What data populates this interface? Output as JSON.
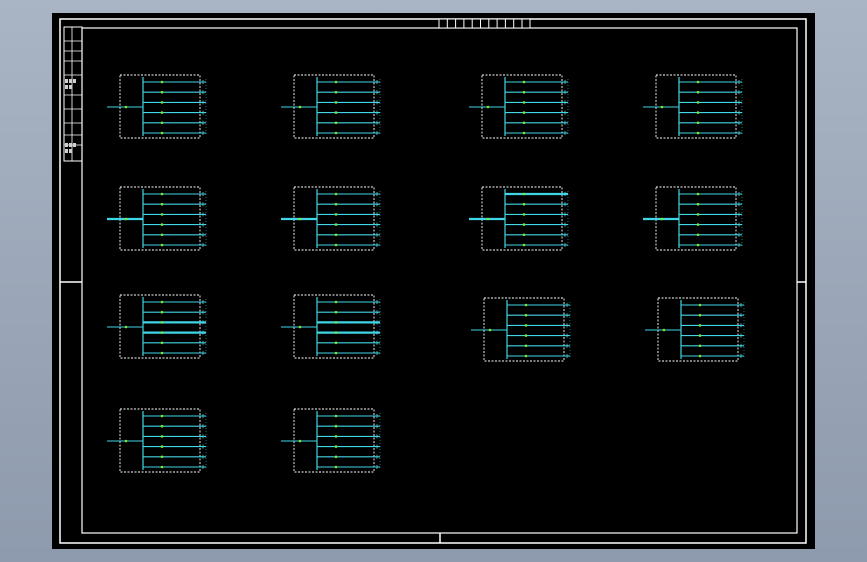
{
  "viewer": {
    "background_color": "#9aa6b8",
    "canvas_color": "#000000"
  },
  "drawing": {
    "frame_color": "#ffffff",
    "wire_color": "#3fd6e6",
    "boundary_color": "#ffffff",
    "junction_color": "#7ee82a",
    "title_block_text": "",
    "modules": [
      {
        "row": 1,
        "col": 1,
        "outputs": 6,
        "highlighted_input": false
      },
      {
        "row": 1,
        "col": 2,
        "outputs": 6,
        "highlighted_input": false
      },
      {
        "row": 1,
        "col": 3,
        "outputs": 6,
        "highlighted_input": false
      },
      {
        "row": 1,
        "col": 4,
        "outputs": 6,
        "highlighted_input": false
      },
      {
        "row": 2,
        "col": 1,
        "outputs": 6,
        "highlighted_input": true
      },
      {
        "row": 2,
        "col": 2,
        "outputs": 6,
        "highlighted_input": true
      },
      {
        "row": 2,
        "col": 3,
        "outputs": 6,
        "highlighted_input": true
      },
      {
        "row": 2,
        "col": 4,
        "outputs": 6,
        "highlighted_input": true
      },
      {
        "row": 3,
        "col": 1,
        "outputs": 6,
        "highlighted_input": false
      },
      {
        "row": 3,
        "col": 2,
        "outputs": 6,
        "highlighted_input": false
      },
      {
        "row": 3,
        "col": 3,
        "outputs": 6,
        "highlighted_input": false
      },
      {
        "row": 3,
        "col": 4,
        "outputs": 6,
        "highlighted_input": false
      },
      {
        "row": 4,
        "col": 1,
        "outputs": 6,
        "highlighted_input": false
      },
      {
        "row": 4,
        "col": 2,
        "outputs": 6,
        "highlighted_input": false
      }
    ]
  }
}
